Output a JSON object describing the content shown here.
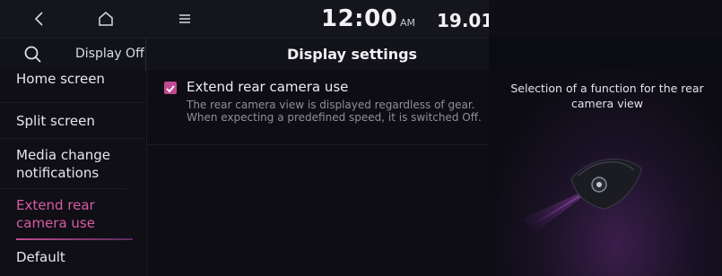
{
  "topbar": {
    "back_icon": "back-chevron-icon",
    "home_icon": "home-icon",
    "menu_icon": "menu-icon",
    "time": "12:00",
    "ampm": "AM",
    "date": "19.01"
  },
  "header": {
    "search_icon": "search-icon",
    "display_off": "Display Off",
    "title": "Display settings"
  },
  "sidebar": {
    "items": [
      {
        "label": "Home screen"
      },
      {
        "label": "Split screen"
      },
      {
        "label": "Media change notifications"
      },
      {
        "label": "Extend rear camera use",
        "active": true
      },
      {
        "label": "Default"
      }
    ]
  },
  "content": {
    "option_label": "Extend rear camera use",
    "option_checked": true,
    "option_desc": "The rear camera view is displayed regardless of gear. When expecting a predefined speed, it is switched Off."
  },
  "info": {
    "text": "Selection of a function for the rear camera view",
    "illustration_icon": "rear-camera-icon"
  },
  "colors": {
    "accent": "#c04a92",
    "active_text": "#d95aa6"
  }
}
